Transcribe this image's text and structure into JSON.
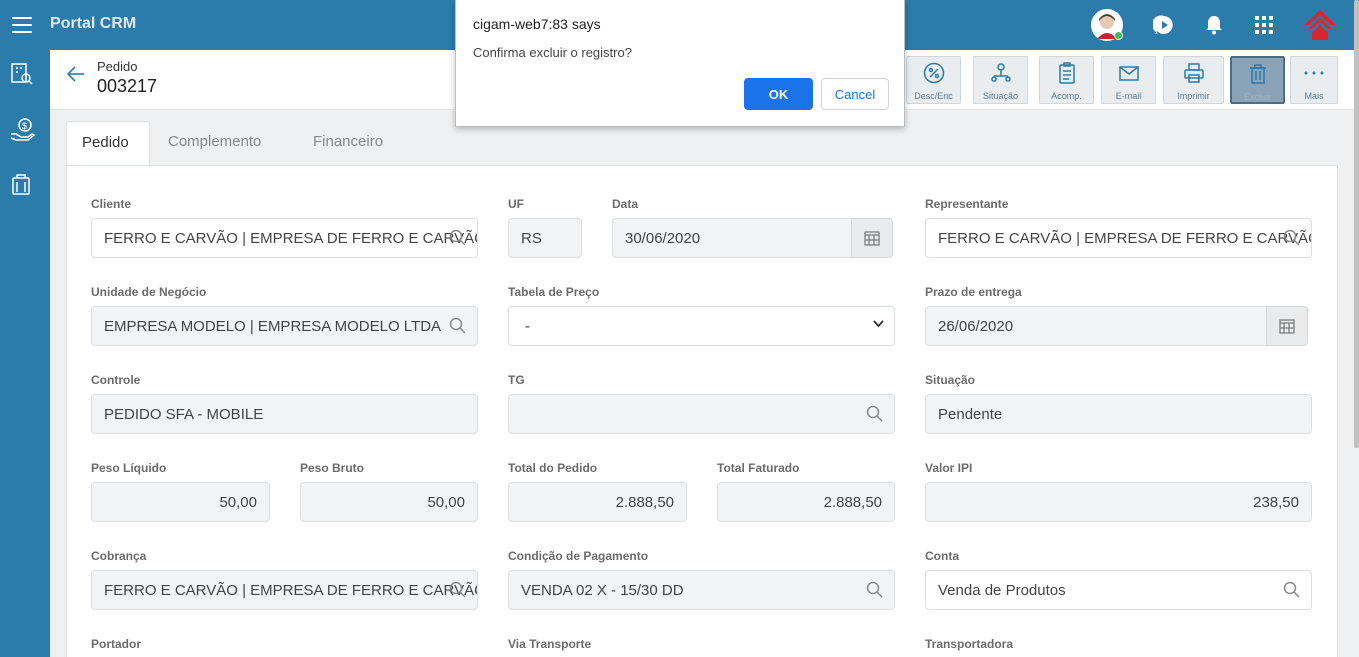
{
  "app": {
    "title": "Portal CRM"
  },
  "header": {
    "subtitle": "Pedido",
    "number": "003217"
  },
  "toolbar": [
    {
      "id": "desc",
      "label": "Desc/Enc",
      "icon": "percent-icon"
    },
    {
      "id": "situacao",
      "label": "Situação",
      "icon": "workflow-icon"
    },
    {
      "id": "acomp",
      "label": "Acomp.",
      "icon": "clipboard-icon"
    },
    {
      "id": "email",
      "label": "E-mail",
      "icon": "mail-icon"
    },
    {
      "id": "imprimir",
      "label": "Imprimir",
      "icon": "printer-icon"
    },
    {
      "id": "excluir",
      "label": "Excluir",
      "icon": "trash-icon"
    },
    {
      "id": "mais",
      "label": "Mais",
      "icon": "more-icon"
    }
  ],
  "tabs": [
    "Pedido",
    "Complemento",
    "Financeiro"
  ],
  "form": {
    "cliente": {
      "label": "Cliente",
      "value": "FERRO E CARVÃO | EMPRESA DE FERRO E CARVÃO LTDA"
    },
    "uf": {
      "label": "UF",
      "value": "RS"
    },
    "data": {
      "label": "Data",
      "value": "30/06/2020"
    },
    "representante": {
      "label": "Representante",
      "value": "FERRO E CARVÃO | EMPRESA DE FERRO E CARVÃO LTDA"
    },
    "unidade": {
      "label": "Unidade de Negócio",
      "value": "EMPRESA MODELO | EMPRESA MODELO LTDA"
    },
    "tabela": {
      "label": "Tabela de Preço",
      "value": "-"
    },
    "prazo": {
      "label": "Prazo de entrega",
      "value": "26/06/2020"
    },
    "controle": {
      "label": "Controle",
      "value": "PEDIDO SFA - MOBILE"
    },
    "tg": {
      "label": "TG",
      "value": ""
    },
    "situacao": {
      "label": "Situação",
      "value": "Pendente"
    },
    "peso_liquido": {
      "label": "Peso Líquido",
      "value": "50,00"
    },
    "peso_bruto": {
      "label": "Peso Bruto",
      "value": "50,00"
    },
    "total_pedido": {
      "label": "Total do Pedido",
      "value": "2.888,50"
    },
    "total_faturado": {
      "label": "Total Faturado",
      "value": "2.888,50"
    },
    "valor_ipi": {
      "label": "Valor IPI",
      "value": "238,50"
    },
    "cobranca": {
      "label": "Cobrança",
      "value": "FERRO E CARVÃO | EMPRESA DE FERRO E CARVÃO LTDA"
    },
    "condicao": {
      "label": "Condição de Pagamento",
      "value": "VENDA 02 X - 15/30 DD"
    },
    "conta": {
      "label": "Conta",
      "value": "Venda de Produtos"
    },
    "portador": {
      "label": "Portador"
    },
    "via_transporte": {
      "label": "Via Transporte"
    },
    "transportadora": {
      "label": "Transportadora"
    }
  },
  "dialog": {
    "title": "cigam-web7:83 says",
    "message": "Confirma excluir o registro?",
    "ok": "OK",
    "cancel": "Cancel"
  },
  "colors": {
    "primary": "#2b7bab",
    "ok_button": "#1a73e8"
  }
}
